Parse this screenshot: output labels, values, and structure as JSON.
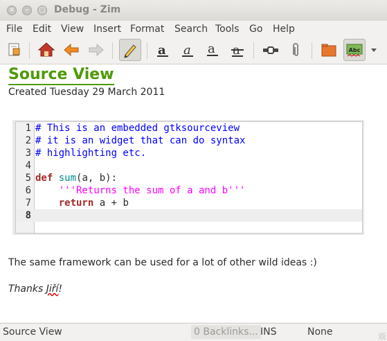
{
  "window": {
    "title": "Debug - Zim",
    "close_glyph": "×",
    "min_glyph": "–",
    "max_glyph": "□"
  },
  "menubar": {
    "items": [
      "File",
      "Edit",
      "View",
      "Insert",
      "Format",
      "Search",
      "Tools",
      "Go",
      "Help"
    ]
  },
  "toolbar": {
    "icons": [
      "page-icon",
      "home-icon",
      "back-arrow-icon",
      "forward-arrow-icon",
      "edit-pencil-icon",
      "bold-icon",
      "italic-icon",
      "underline-icon",
      "strike-icon",
      "link-icon",
      "attach-icon",
      "folder-icon",
      "spellcheck-icon",
      "dropdown-arrow-icon"
    ],
    "spell_label": "Abc"
  },
  "page": {
    "heading": "Source View",
    "created": "Created Tuesday 29 March 2011",
    "code_lines": [
      {
        "num": "1",
        "tokens": [
          {
            "t": "# This is an embedded gtksourceview",
            "c": "c-comment"
          }
        ]
      },
      {
        "num": "2",
        "tokens": [
          {
            "t": "# it is an widget that can do syntax",
            "c": "c-comment"
          }
        ]
      },
      {
        "num": "3",
        "tokens": [
          {
            "t": "# highlighting etc.",
            "c": "c-comment"
          }
        ]
      },
      {
        "num": "4",
        "tokens": []
      },
      {
        "num": "5",
        "tokens": [
          {
            "t": "def",
            "c": "c-kw"
          },
          {
            "t": " ",
            "c": "c-plain"
          },
          {
            "t": "sum",
            "c": "c-fn"
          },
          {
            "t": "(a, b):",
            "c": "c-plain"
          }
        ]
      },
      {
        "num": "6",
        "tokens": [
          {
            "t": "    ",
            "c": "c-plain"
          },
          {
            "t": "'''Returns the sum of a and b'''",
            "c": "c-str"
          }
        ]
      },
      {
        "num": "7",
        "tokens": [
          {
            "t": "    ",
            "c": "c-plain"
          },
          {
            "t": "return",
            "c": "c-kw"
          },
          {
            "t": " a + b",
            "c": "c-plain"
          }
        ]
      },
      {
        "num": "8",
        "tokens": [],
        "current": true
      }
    ],
    "paragraph": "The same framework can be used for a lot of other wild ideas :)",
    "thanks_word": "Thanks ",
    "thanks_name": "Jiří",
    "thanks_end": "!"
  },
  "statusbar": {
    "page": "Source View",
    "backlinks": "0 Backlinks...",
    "mode": "INS",
    "style": "None"
  },
  "colors": {
    "accent": "#4e9a06",
    "comment": "#0000ff",
    "keyword": "#a52a2a",
    "string": "#ff00ff",
    "function": "#008b8b"
  }
}
